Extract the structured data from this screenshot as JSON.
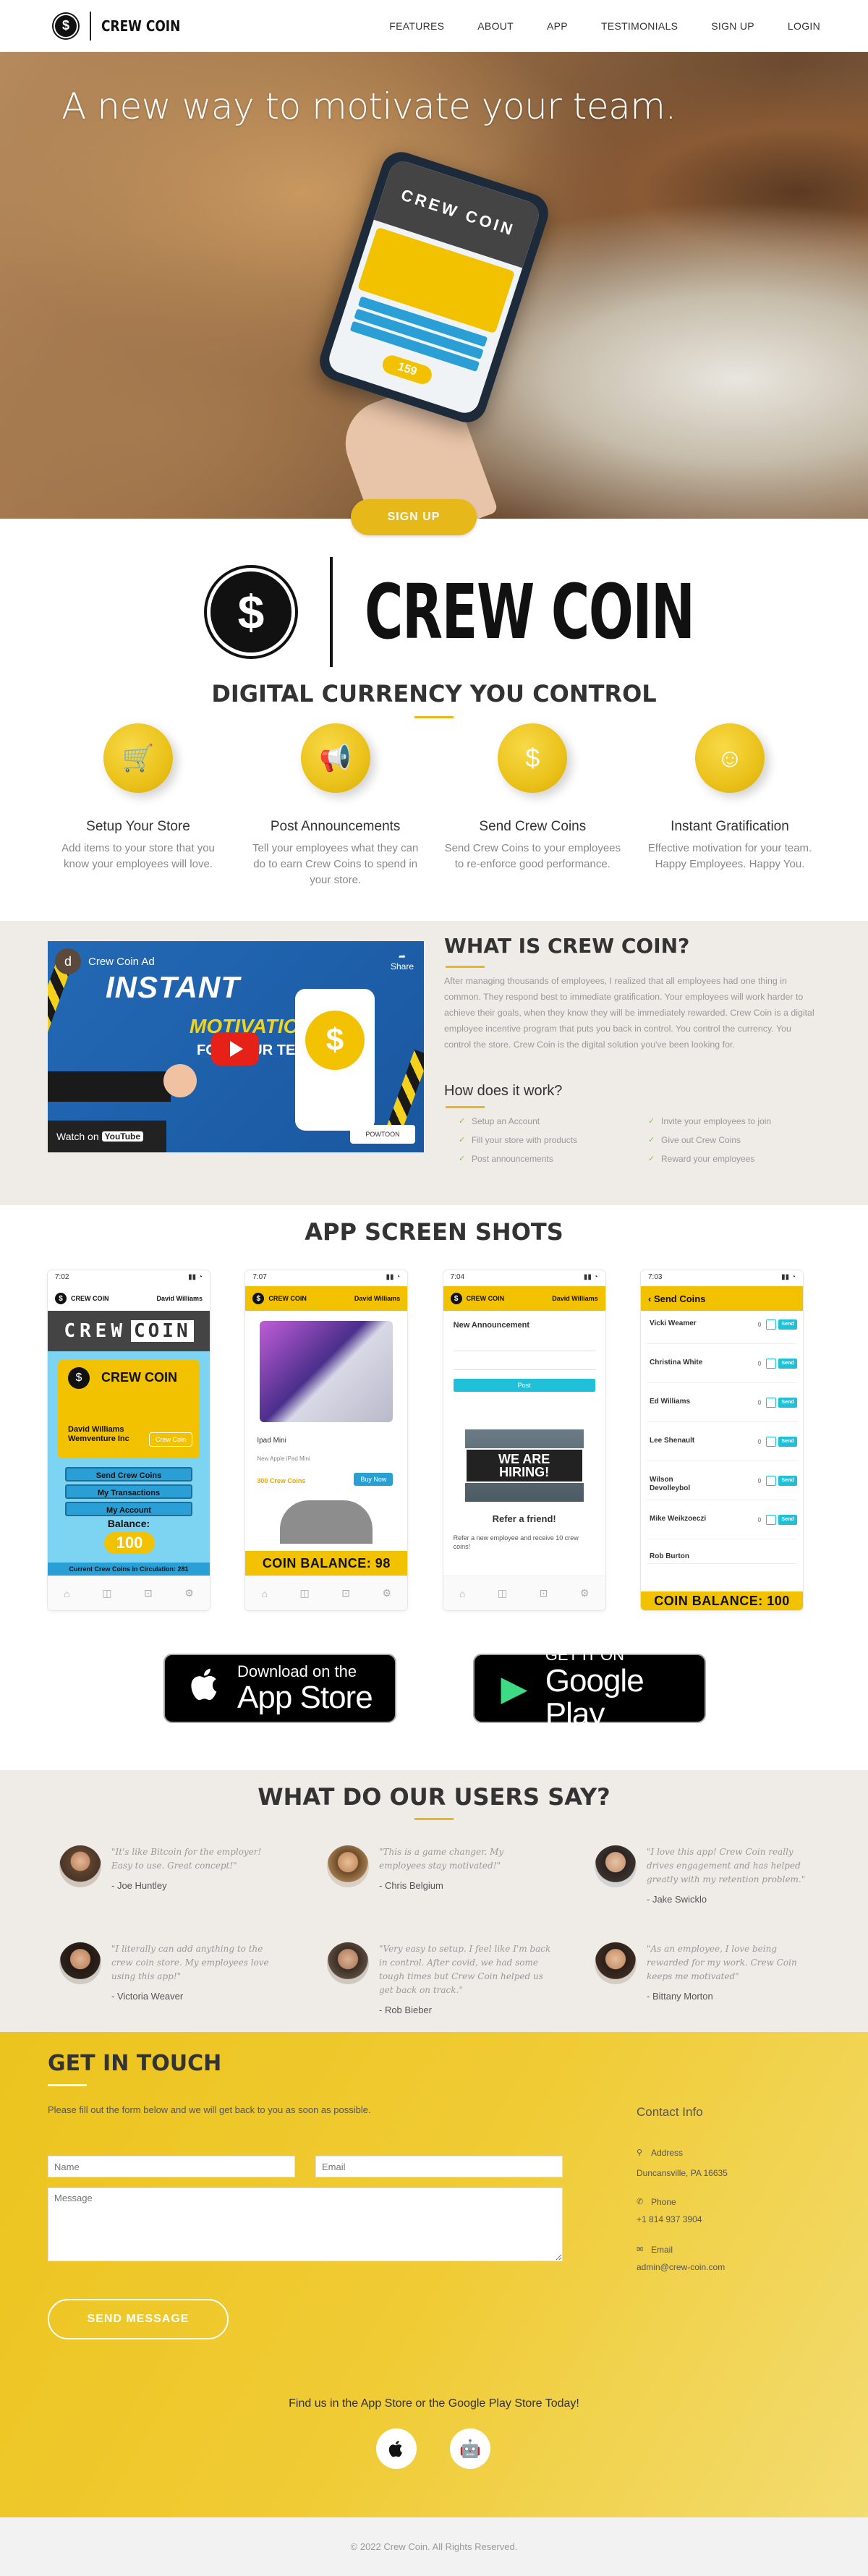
{
  "nav": {
    "brand": "CREW COIN",
    "links": [
      "FEATURES",
      "ABOUT",
      "APP",
      "TESTIMONIALS",
      "SIGN UP",
      "LOGIN"
    ]
  },
  "hero": {
    "title": "A new way to motivate your team.",
    "signup_label": "SIGN UP",
    "phone": {
      "banner": "CREW COIN",
      "balance": "159"
    }
  },
  "logo": {
    "symbol": "$",
    "name": "CREW COIN"
  },
  "features": {
    "title": "DIGITAL CURRENCY YOU CONTROL",
    "items": [
      {
        "icon": "cart-icon",
        "glyph": "🛒",
        "title": "Setup Your Store",
        "desc": "Add items to your store that you know your employees will love."
      },
      {
        "icon": "megaphone-icon",
        "glyph": "📢",
        "title": "Post Announcements",
        "desc": "Tell your employees what they can do to earn Crew Coins to spend in your store."
      },
      {
        "icon": "dollar-icon",
        "glyph": "$",
        "title": "Send Crew Coins",
        "desc": "Send Crew Coins to your employees to re-enforce good performance."
      },
      {
        "icon": "smile-icon",
        "glyph": "☺",
        "title": "Instant Gratification",
        "desc": "Effective motivation for your team. Happy Employees. Happy You."
      }
    ]
  },
  "whatis": {
    "video": {
      "channel_initial": "d",
      "title": "Crew Coin Ad",
      "share": "Share",
      "headline": "INSTANT",
      "sub": "MOTIVATION",
      "sub2": "FOR YOUR TEAM!",
      "watch": "Watch on",
      "youtube": "YouTube",
      "powtoon": "POWTOON"
    },
    "title": "WHAT IS CREW COIN?",
    "text": "After managing thousands of employees, I realized that all employees had one thing in common. They respond best to immediate gratification. Your employees will work harder to achieve their goals, when they know they will be immediately rewarded. Crew Coin is a digital employee incentive program that puts you back in control. You control the currency. You control the store. Crew Coin is the digital solution you've been looking for.",
    "how_title": "How does it work?",
    "steps": [
      "Setup an Account",
      "Invite your employees to join",
      "Fill your store with products",
      "Give out Crew Coins",
      "Post announcements",
      "Reward your employees"
    ]
  },
  "screens": {
    "title": "APP SCREEN SHOTS",
    "s1": {
      "time": "7:02",
      "brand": "CREW COIN",
      "user": "David Williams",
      "crew_a": "CREW",
      "crew_b": "COIN",
      "card_title": "CREW COIN",
      "card_name": "David Williams",
      "card_company": "Wemventure Inc",
      "card_tag": "Crew Coin",
      "menu": [
        "Send Crew Coins",
        "My Transactions",
        "My Account"
      ],
      "balance_label": "Balance:",
      "balance": "100",
      "circulation": "Current Crew Coins in Circulation: 281"
    },
    "s2": {
      "time": "7:07",
      "brand": "CREW COIN",
      "user": "David Williams",
      "product": "Ipad Mini",
      "product_sub": "New Apple iPad Mini",
      "price": "300 Crew Coins",
      "buy": "Buy Now",
      "banner": "COIN BALANCE: 98"
    },
    "s3": {
      "time": "7:04",
      "brand": "CREW COIN",
      "user": "David Williams",
      "heading": "New Announcement",
      "post": "Post",
      "sign": "WE ARE HIRING!",
      "refer": "Refer a friend!",
      "refer_sub": "Refer a new employee and receive 10 crew coins!"
    },
    "s4": {
      "time": "7:03",
      "header": "Send Coins",
      "people": [
        "Vicki Weamer",
        "Christina White",
        "Ed Williams",
        "Lee Shenault",
        "Wilson Devolleybol",
        "Mike Weikzoeczi",
        "Rob Burton"
      ],
      "send": "Send",
      "banner": "COIN BALANCE: 100"
    }
  },
  "stores": {
    "apple": {
      "small": "Download on the",
      "big": "App Store"
    },
    "google": {
      "small": "GET IT ON",
      "big": "Google Play"
    }
  },
  "testimonials": {
    "title": "WHAT DO OUR USERS SAY?",
    "items": [
      {
        "quote": "\"It's like Bitcoin for the employer! Easy to use. Great concept!\"",
        "author": "- Joe Huntley"
      },
      {
        "quote": "\"This is a game changer. My employees stay motivated!\"",
        "author": "- Chris Belgium"
      },
      {
        "quote": "\"I love this app! Crew Coin really drives engagement and has helped greatly with my retention problem.\"",
        "author": "- Jake Swicklo"
      },
      {
        "quote": "\"I literally can add anything to the crew coin store. My employees love using this app!\"",
        "author": "- Victoria Weaver"
      },
      {
        "quote": "\"Very easy to setup. I feel like I'm back in control. After covid, we had some tough times but Crew Coin helped us get back on track.\"",
        "author": "- Rob Bieber"
      },
      {
        "quote": "\"As an employee, I love being rewarded for my work. Crew Coin keeps me motivated\"",
        "author": "- Bittany Morton"
      }
    ]
  },
  "contact": {
    "title": "GET IN TOUCH",
    "subtitle": "Please fill out the form below and we will get back to you as soon as possible.",
    "name_placeholder": "Name",
    "email_placeholder": "Email",
    "message_placeholder": "Message",
    "send_label": "SEND MESSAGE",
    "info_title": "Contact Info",
    "address_label": "Address",
    "address": "Duncansville, PA 16635",
    "phone_label": "Phone",
    "phone": "+1 814 937 3904",
    "email_label": "Email",
    "email": "admin@crew-coin.com",
    "find": "Find us in the App Store or the Google Play Store Today!"
  },
  "footer": {
    "copyright": "© 2022 Crew Coin. All Rights Reserved."
  },
  "colors": {
    "accent": "#e6b81a",
    "contact_bg": "#f0cb34",
    "section_bg": "#efece8"
  }
}
